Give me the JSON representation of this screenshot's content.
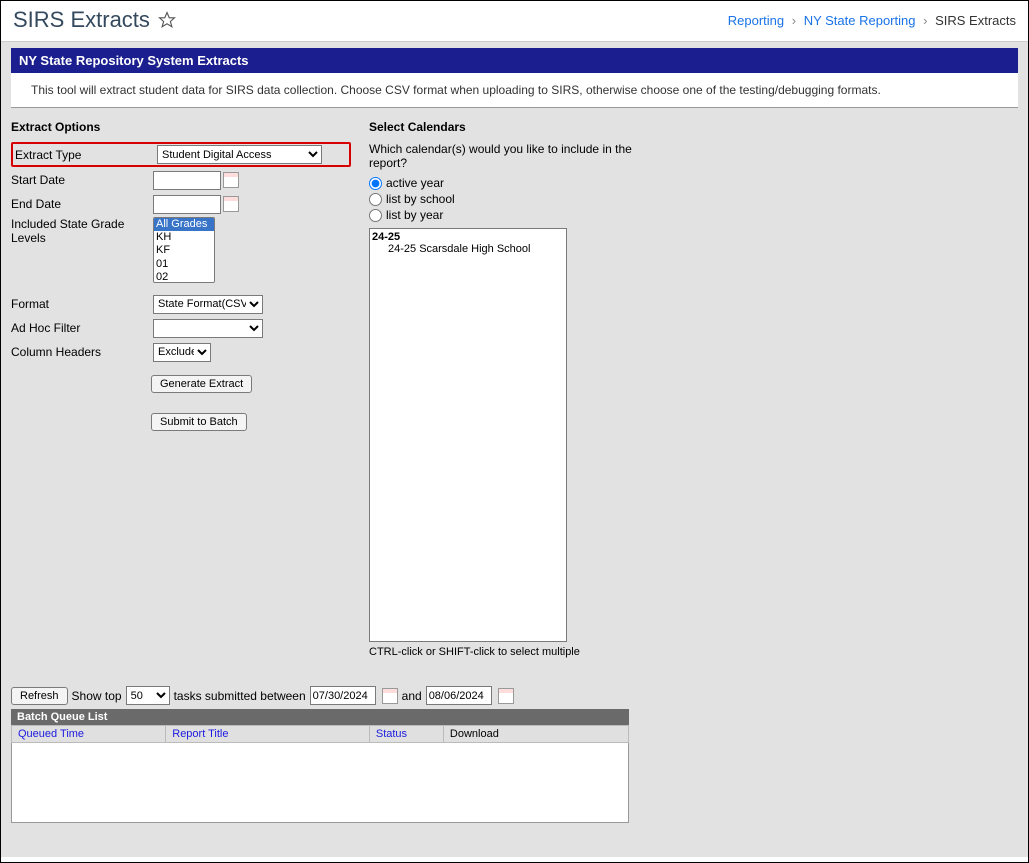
{
  "header": {
    "title": "SIRS Extracts"
  },
  "breadcrumb": {
    "item1": "Reporting",
    "item2": "NY State Reporting",
    "item3": "SIRS Extracts"
  },
  "banner": "NY State Repository System Extracts",
  "description": "This tool will extract student data for SIRS data collection. Choose CSV format when uploading to SIRS, otherwise choose one of the testing/debugging formats.",
  "extractOptions": {
    "title": "Extract Options",
    "labels": {
      "extractType": "Extract Type",
      "startDate": "Start Date",
      "endDate": "End Date",
      "gradeLevels": "Included State Grade Levels",
      "format": "Format",
      "adHoc": "Ad Hoc Filter",
      "columnHeaders": "Column Headers"
    },
    "values": {
      "extractType": "Student Digital Access",
      "startDate": "",
      "endDate": "",
      "format": "State Format(CSV)",
      "adHoc": "",
      "columnHeaders": "Exclude"
    },
    "gradeOptions": {
      "o0": "All Grades",
      "o1": "KH",
      "o2": "KF",
      "o3": "01",
      "o4": "02"
    },
    "buttons": {
      "generate": "Generate Extract",
      "submit": "Submit to Batch"
    }
  },
  "calendars": {
    "title": "Select Calendars",
    "prompt": "Which calendar(s) would you like to include in the report?",
    "options": {
      "active": "active year",
      "bySchool": "list by school",
      "byYear": "list by year"
    },
    "list": {
      "year": "24-25",
      "school": "24-25 Scarsdale High School"
    },
    "hint": "CTRL-click or SHIFT-click to select multiple"
  },
  "batch": {
    "refresh": "Refresh",
    "showTopLabel": "Show top",
    "showTopValue": "50",
    "betweenLabel": "tasks submitted between",
    "date1": "07/30/2024",
    "andLabel": "and",
    "date2": "08/06/2024",
    "queueTitle": "Batch Queue List",
    "cols": {
      "queued": "Queued Time",
      "title": "Report Title",
      "status": "Status",
      "download": "Download"
    }
  }
}
